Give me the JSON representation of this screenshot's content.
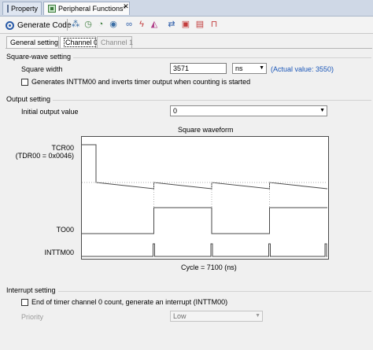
{
  "doc_tabs": [
    {
      "label": "Property",
      "icon": "property-icon"
    },
    {
      "label": "Peripheral Functions*",
      "icon": "peripheral-functions-icon"
    }
  ],
  "tab_close_glyph": "✕",
  "toolbar": {
    "generate_label": "Generate Code",
    "buttons": [
      "tree-view-icon",
      "clock-icon",
      "timer-icon",
      "watchdog-icon",
      "link-icon",
      "flash-icon",
      "eraser-icon",
      "interrupt-icon",
      "chip-icon",
      "lock-icon"
    ]
  },
  "channel_tabs": {
    "general": "General setting",
    "channel0": "Channel 0",
    "channel1": "Channel 1"
  },
  "square_wave": {
    "title": "Square-wave setting",
    "width_label": "Square width",
    "width_value": "3571",
    "unit": "ns",
    "actual_value": "(Actual value: 3550)",
    "generate_int_label": "Generates INTTM00 and inverts timer output when counting is started",
    "generate_int_checked": false
  },
  "output_setting": {
    "title": "Output setting",
    "initial_label": "Initial output value",
    "initial_value": "0"
  },
  "waveform": {
    "title": "Square waveform",
    "tcr_label": "TCR00",
    "tdr_label": "(TDR00 = 0x0046)",
    "to_label": "TO00",
    "int_label": "INTTM00",
    "cycle_label": "Cycle = 7100 (ns)",
    "periods_shown": 4
  },
  "interrupt_setting": {
    "title": "Interrupt setting",
    "end_int_label": "End of timer channel 0 count, generate an interrupt (INTTM00)",
    "end_int_checked": false,
    "priority_label": "Priority",
    "priority_value": "Low"
  },
  "arrow_glyph": "▼",
  "colors": {
    "link_blue": "#1a56b8",
    "waveform_line": "#4a4a4a",
    "disabled_text": "#9a9a9a"
  }
}
